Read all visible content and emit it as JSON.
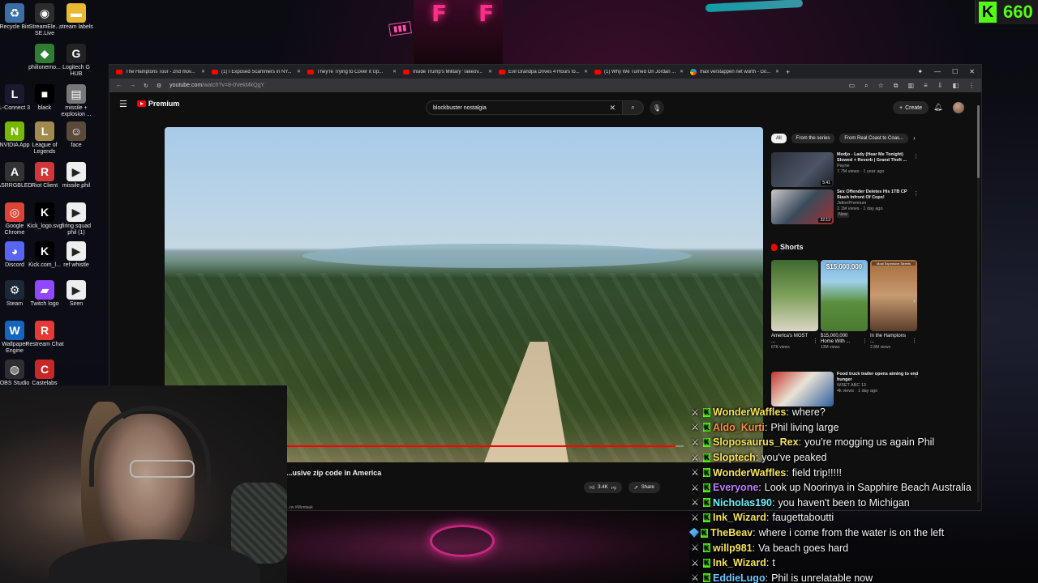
{
  "stream_overlay": {
    "counter_value": "660",
    "counter_icon": "kick-k-icon",
    "accent": "#53fc18"
  },
  "desktop": {
    "icons": [
      {
        "label": "Recycle Bin",
        "icon": "recycle-bin-icon",
        "color": "#3a6ea5",
        "glyph": "♻"
      },
      {
        "label": "StreamEle... SE.Live",
        "icon": "streamelements-icon",
        "color": "#2c2c2c",
        "glyph": "◉"
      },
      {
        "label": "stream labels",
        "icon": "folder-icon",
        "color": "#e8b931",
        "glyph": "▬"
      },
      {
        "label": "philionemo...",
        "icon": "app-icon",
        "color": "#2e7d32",
        "glyph": "◆"
      },
      {
        "label": "Logitech G HUB",
        "icon": "logitech-icon",
        "color": "#222",
        "glyph": "G"
      },
      {
        "label": "L-Connect 3",
        "icon": "lconnect-icon",
        "color": "#1a1a2e",
        "glyph": "L"
      },
      {
        "label": "black",
        "icon": "image-icon",
        "color": "#000",
        "glyph": "■"
      },
      {
        "label": "missile + explosion ...",
        "icon": "file-icon",
        "color": "#777",
        "glyph": "▤"
      },
      {
        "label": "NVIDIA App",
        "icon": "nvidia-icon",
        "color": "#76b900",
        "glyph": "N"
      },
      {
        "label": "League of Legends",
        "icon": "league-icon",
        "color": "#a08a4e",
        "glyph": "L"
      },
      {
        "label": "face",
        "icon": "image-icon",
        "color": "#5a4a3a",
        "glyph": "☺"
      },
      {
        "label": "ASRRGBLED",
        "icon": "asrock-icon",
        "color": "#333",
        "glyph": "A"
      },
      {
        "label": "Riot Client",
        "icon": "riot-icon",
        "color": "#d13639",
        "glyph": "R"
      },
      {
        "label": "missile phil",
        "icon": "media-icon",
        "color": "#eee",
        "glyph": "▶"
      },
      {
        "label": "Google Chrome",
        "icon": "chrome-icon",
        "color": "#db4437",
        "glyph": "◎"
      },
      {
        "label": "Kick_logo.svg",
        "icon": "kick-icon",
        "color": "#000",
        "glyph": "K"
      },
      {
        "label": "firing squad phil (1)",
        "icon": "media-icon",
        "color": "#eee",
        "glyph": "▶"
      },
      {
        "label": "Discord",
        "icon": "discord-icon",
        "color": "#5865f2",
        "glyph": "◕"
      },
      {
        "label": "Kick.com_l...",
        "icon": "kick-icon",
        "color": "#000",
        "glyph": "K"
      },
      {
        "label": "ref whistle",
        "icon": "media-icon",
        "color": "#eee",
        "glyph": "▶"
      },
      {
        "label": "Steam",
        "icon": "steam-icon",
        "color": "#1b2838",
        "glyph": "⚙"
      },
      {
        "label": "Twitch logo",
        "icon": "twitch-icon",
        "color": "#9146ff",
        "glyph": "▰"
      },
      {
        "label": "Siren",
        "icon": "media-icon",
        "color": "#eee",
        "glyph": "▶"
      },
      {
        "label": "Wallpaper Engine",
        "icon": "wallpaper-engine-icon",
        "color": "#1565c0",
        "glyph": "W"
      },
      {
        "label": "Restream Chat",
        "icon": "restream-icon",
        "color": "#e53935",
        "glyph": "R"
      },
      {
        "label": "OBS Studio",
        "icon": "obs-icon",
        "color": "#302e31",
        "glyph": "◍"
      },
      {
        "label": "Castelabs",
        "icon": "castelabs-icon",
        "color": "#c62828",
        "glyph": "C"
      }
    ]
  },
  "browser": {
    "tabs": [
      {
        "title": "The Hamptons Tour - 2nd mov...",
        "kind": "yt"
      },
      {
        "title": "(1) I Exposed Scammers in NY...",
        "kind": "yt"
      },
      {
        "title": "They're Trying to Cover it Up...",
        "kind": "yt"
      },
      {
        "title": "Inside Trump's Military 'Takeov...",
        "kind": "yt"
      },
      {
        "title": "Evil Grandpa Drives 4 Hours to...",
        "kind": "yt"
      },
      {
        "title": "(1) Why We Turned On Jordan ...",
        "kind": "yt"
      },
      {
        "title": "max verstappen net worth - Go...",
        "kind": "google"
      }
    ],
    "url_host": "youtube.com",
    "url_path": "/watch?v=8-0VekMkQgY"
  },
  "youtube": {
    "logo_text": "Premium",
    "search_query": "blockbuster nostalgia",
    "create_label": "Create",
    "video_title": "...usive zip code in America",
    "like_count": "3.4K",
    "share_label": "Share",
    "hashtag": "...ns #Montauk",
    "progress_fraction": 0.98,
    "chips": [
      {
        "label": "All",
        "active": true
      },
      {
        "label": "From the series",
        "active": false
      },
      {
        "label": "From Real Coast to Coas...",
        "active": false
      }
    ],
    "recommendations": [
      {
        "title": "Modjo - Lady (Hear Me Tonight) Slowed + Reverb | Grand Theft ...",
        "channel": "Payne",
        "meta": "7.7M views · 1 year ago",
        "duration": "5:41",
        "badge": ""
      },
      {
        "title": "Sex Offender Deletes His 1TB CP Stash Infront Of Cops!",
        "channel": "JidionPremium",
        "meta": "2.1M views · 1 day ago",
        "duration": "22:13",
        "badge": "New"
      },
      {
        "title": "Food truck trailer opens aiming to end hunger",
        "channel": "WSET ABC 13",
        "meta": "4k views · 1 day ago",
        "duration": "",
        "badge": ""
      }
    ],
    "shorts_title": "Shorts",
    "shorts": [
      {
        "title": "America's MOST ...",
        "views": "67K views",
        "overlay": ""
      },
      {
        "title": "$15,000,000 Home With ...",
        "views": "13M views",
        "overlay": "$15,000,000"
      },
      {
        "title": "In the Hamptons ...",
        "views": "2.8M views",
        "overlay": "Most Expensive Streets"
      }
    ]
  },
  "chat": {
    "messages": [
      {
        "badges": [
          "wrench",
          "k"
        ],
        "user": "WonderWaffles",
        "color": "#f5e257",
        "text": "where?"
      },
      {
        "badges": [
          "wrench",
          "k"
        ],
        "user": "Aldo_Kurti",
        "color": "#ff8c3a",
        "text": "Phil living large"
      },
      {
        "badges": [
          "wrench",
          "k"
        ],
        "user": "Sloposaurus_Rex",
        "color": "#f5e257",
        "text": "you're mogging us again Phil"
      },
      {
        "badges": [
          "wrench",
          "k"
        ],
        "user": "Sloptech",
        "color": "#f5e257",
        "text": "you've peaked"
      },
      {
        "badges": [
          "wrench",
          "k"
        ],
        "user": "WonderWaffles",
        "color": "#f5e257",
        "text": "field trip!!!!!"
      },
      {
        "badges": [
          "wrench",
          "k"
        ],
        "user": "Everyone",
        "color": "#c07cff",
        "text": "Look up Noorinya in Sapphire Beach Australia"
      },
      {
        "badges": [
          "wrench",
          "k"
        ],
        "user": "Nicholas190",
        "color": "#6cf2ff",
        "text": "you haven't been to Michigan"
      },
      {
        "badges": [
          "wrench",
          "k"
        ],
        "user": "Ink_Wizard",
        "color": "#f5e257",
        "text": "faugettaboutti"
      },
      {
        "badges": [
          "gem",
          "k"
        ],
        "user": "TheBeav",
        "color": "#f5e257",
        "text": "where i come from the water is on the left"
      },
      {
        "badges": [
          "wrench",
          "k"
        ],
        "user": "willp981",
        "color": "#f5e257",
        "text": "Va beach goes hard"
      },
      {
        "badges": [
          "wrench",
          "k"
        ],
        "user": "Ink_Wizard",
        "color": "#f5e257",
        "text": "t"
      },
      {
        "badges": [
          "wrench",
          "k"
        ],
        "user": "EddieLugo",
        "color": "#6cc8ff",
        "text": "Phil is unrelatable now"
      }
    ]
  }
}
